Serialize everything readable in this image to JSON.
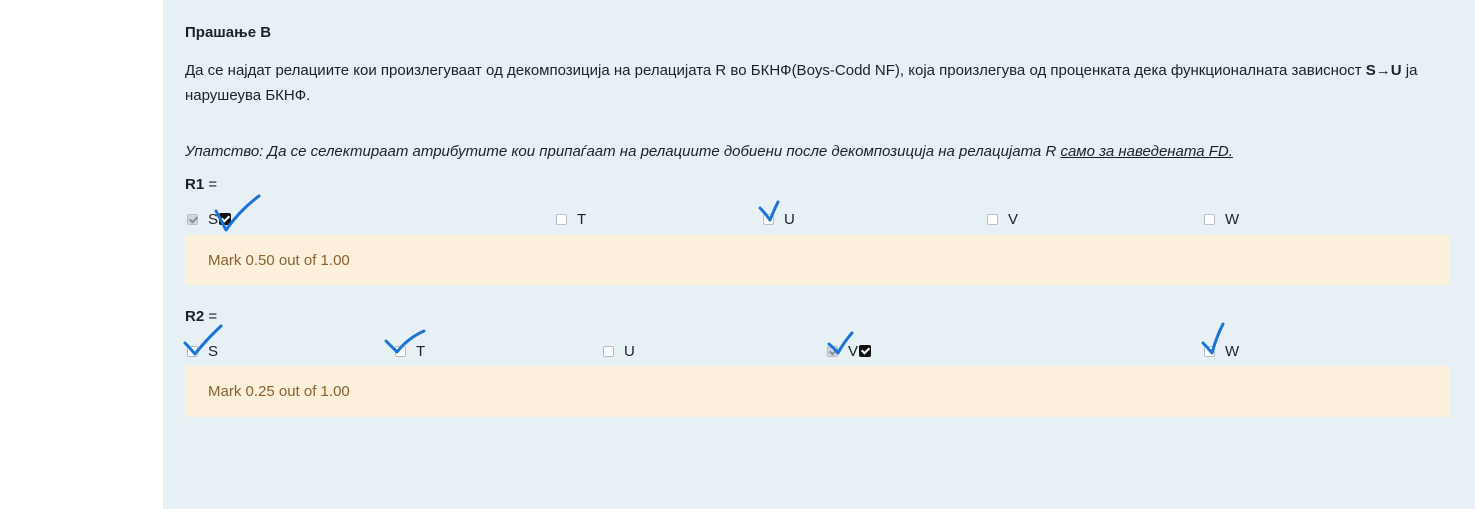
{
  "question": {
    "title": "Прашање B",
    "text_before": "Да се најдат релациите кои произлегуваат од декомпозиција на релацијата R во БКНФ(Boys-Codd NF), која произлегува од проценката дека функционалната зависност ",
    "fd": "S→U",
    "text_after": " ја нарушеува БКНФ.",
    "hint_prefix": "Упатство: Да се селектираат атрибутите кои припаѓаат на релациите добиени после декомпозиција на релацијата R ",
    "hint_underlined": "само за наведената FD."
  },
  "relations": [
    {
      "label": "R1",
      "equals": "=",
      "options": [
        {
          "name": "S",
          "checked": true,
          "correct_mark": true
        },
        {
          "name": "T",
          "checked": false
        },
        {
          "name": "U",
          "checked": false
        },
        {
          "name": "V",
          "checked": false
        },
        {
          "name": "W",
          "checked": false
        }
      ],
      "feedback": "Mark 0.50 out of 1.00"
    },
    {
      "label": "R2",
      "equals": "=",
      "options": [
        {
          "name": "S",
          "checked": false
        },
        {
          "name": "T",
          "checked": false
        },
        {
          "name": "U",
          "checked": false
        },
        {
          "name": "V",
          "checked": true,
          "correct_mark": true
        },
        {
          "name": "W",
          "checked": false
        }
      ],
      "feedback": "Mark 0.25 out of 1.00"
    }
  ],
  "colors": {
    "panel": "#e7f1f5",
    "feedback_bg": "#fcefdc",
    "feedback_text": "#8a6231",
    "ink": "#1a73d9"
  }
}
